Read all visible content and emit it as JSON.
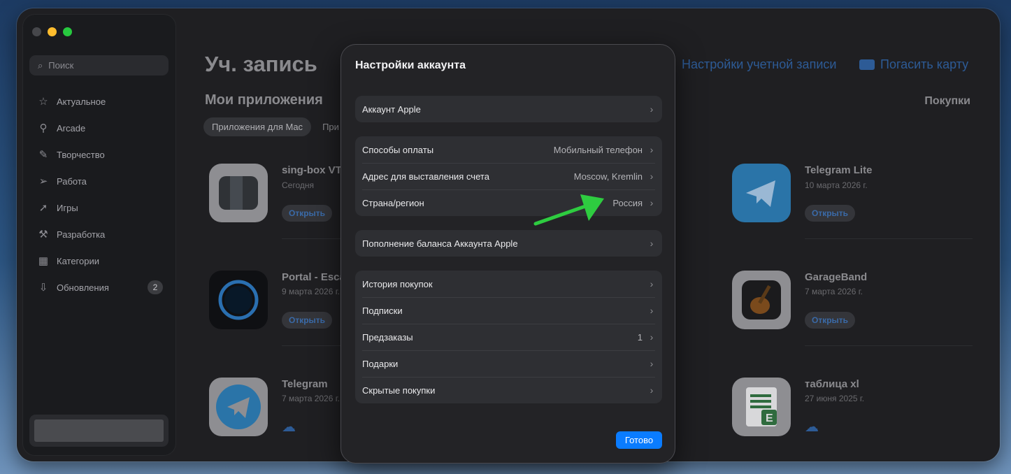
{
  "window": {
    "traffic_colors": [
      "#46474b",
      "#ffbd2e",
      "#27c93f"
    ]
  },
  "sidebar": {
    "search_placeholder": "Поиск",
    "items": [
      {
        "label": "Актуальное",
        "icon": "star-icon"
      },
      {
        "label": "Arcade",
        "icon": "joystick-icon"
      },
      {
        "label": "Творчество",
        "icon": "brush-icon"
      },
      {
        "label": "Работа",
        "icon": "paperplane-icon"
      },
      {
        "label": "Игры",
        "icon": "rocket-icon"
      },
      {
        "label": "Разработка",
        "icon": "hammer-icon"
      },
      {
        "label": "Категории",
        "icon": "grid-icon"
      },
      {
        "label": "Обновления",
        "icon": "download-icon",
        "badge": "2"
      }
    ]
  },
  "main": {
    "title": "Уч. запись",
    "subtitle": "Мои приложения",
    "segments": [
      "Приложения для Mac",
      "При"
    ],
    "account_settings_link": "Настройки учетной записи",
    "redeem_link": "Погасить карту",
    "purchases_heading": "Покупки",
    "open_label": "Открыть",
    "apps_left": [
      {
        "name": "sing-box VT",
        "date": "Сегодня",
        "action": "open"
      },
      {
        "name": "Portal - Esca",
        "date": "9 марта 2026 г.",
        "action": "open"
      },
      {
        "name": "Telegram",
        "date": "7 марта 2026 г.",
        "action": "download"
      }
    ],
    "apps_right": [
      {
        "name": "Telegram Lite",
        "date": "10 марта 2026 г.",
        "action": "open"
      },
      {
        "name": "GarageBand",
        "date": "7 марта 2026 г.",
        "action": "open"
      },
      {
        "name": "таблица xl",
        "date": "27 июня 2025 г.",
        "action": "download"
      }
    ]
  },
  "modal": {
    "title": "Настройки аккаунта",
    "groups": [
      [
        {
          "label": "Аккаунт Apple",
          "value": ""
        }
      ],
      [
        {
          "label": "Способы оплаты",
          "value": "Мобильный телефон"
        },
        {
          "label": "Адрес для выставления счета",
          "value": "Moscow, Kremlin"
        },
        {
          "label": "Страна/регион",
          "value": "Россия"
        }
      ],
      [
        {
          "label": "Пополнение баланса Аккаунта Apple",
          "value": ""
        }
      ],
      [
        {
          "label": "История покупок",
          "value": ""
        },
        {
          "label": "Подписки",
          "value": ""
        },
        {
          "label": "Предзаказы",
          "value": "1"
        },
        {
          "label": "Подарки",
          "value": ""
        },
        {
          "label": "Скрытые покупки",
          "value": ""
        }
      ]
    ],
    "done_label": "Готово",
    "accent_color": "#0a7cff",
    "arrow_color": "#2ecc40"
  }
}
